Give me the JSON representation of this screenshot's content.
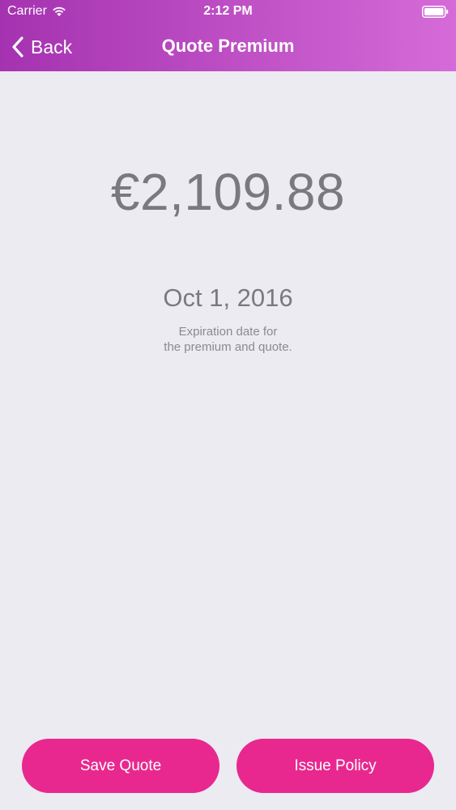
{
  "status_bar": {
    "carrier": "Carrier",
    "time": "2:12 PM",
    "icons": [
      "wifi-icon",
      "battery-icon"
    ]
  },
  "nav": {
    "back_label": "Back",
    "title": "Quote Premium",
    "icons": [
      "chevron-left-icon"
    ]
  },
  "quote": {
    "amount": "€2,109.88",
    "expiration_date": "Oct 1, 2016",
    "caption_line1": "Expiration date for",
    "caption_line2": "the premium and quote."
  },
  "actions": {
    "save_label": "Save Quote",
    "issue_label": "Issue Policy"
  },
  "colors": {
    "header_gradient_start": "#a532b0",
    "header_gradient_end": "#d56bd8",
    "button_bg": "#e8288f",
    "background": "#ebebf1",
    "text_gray": "#7a7a7e"
  }
}
